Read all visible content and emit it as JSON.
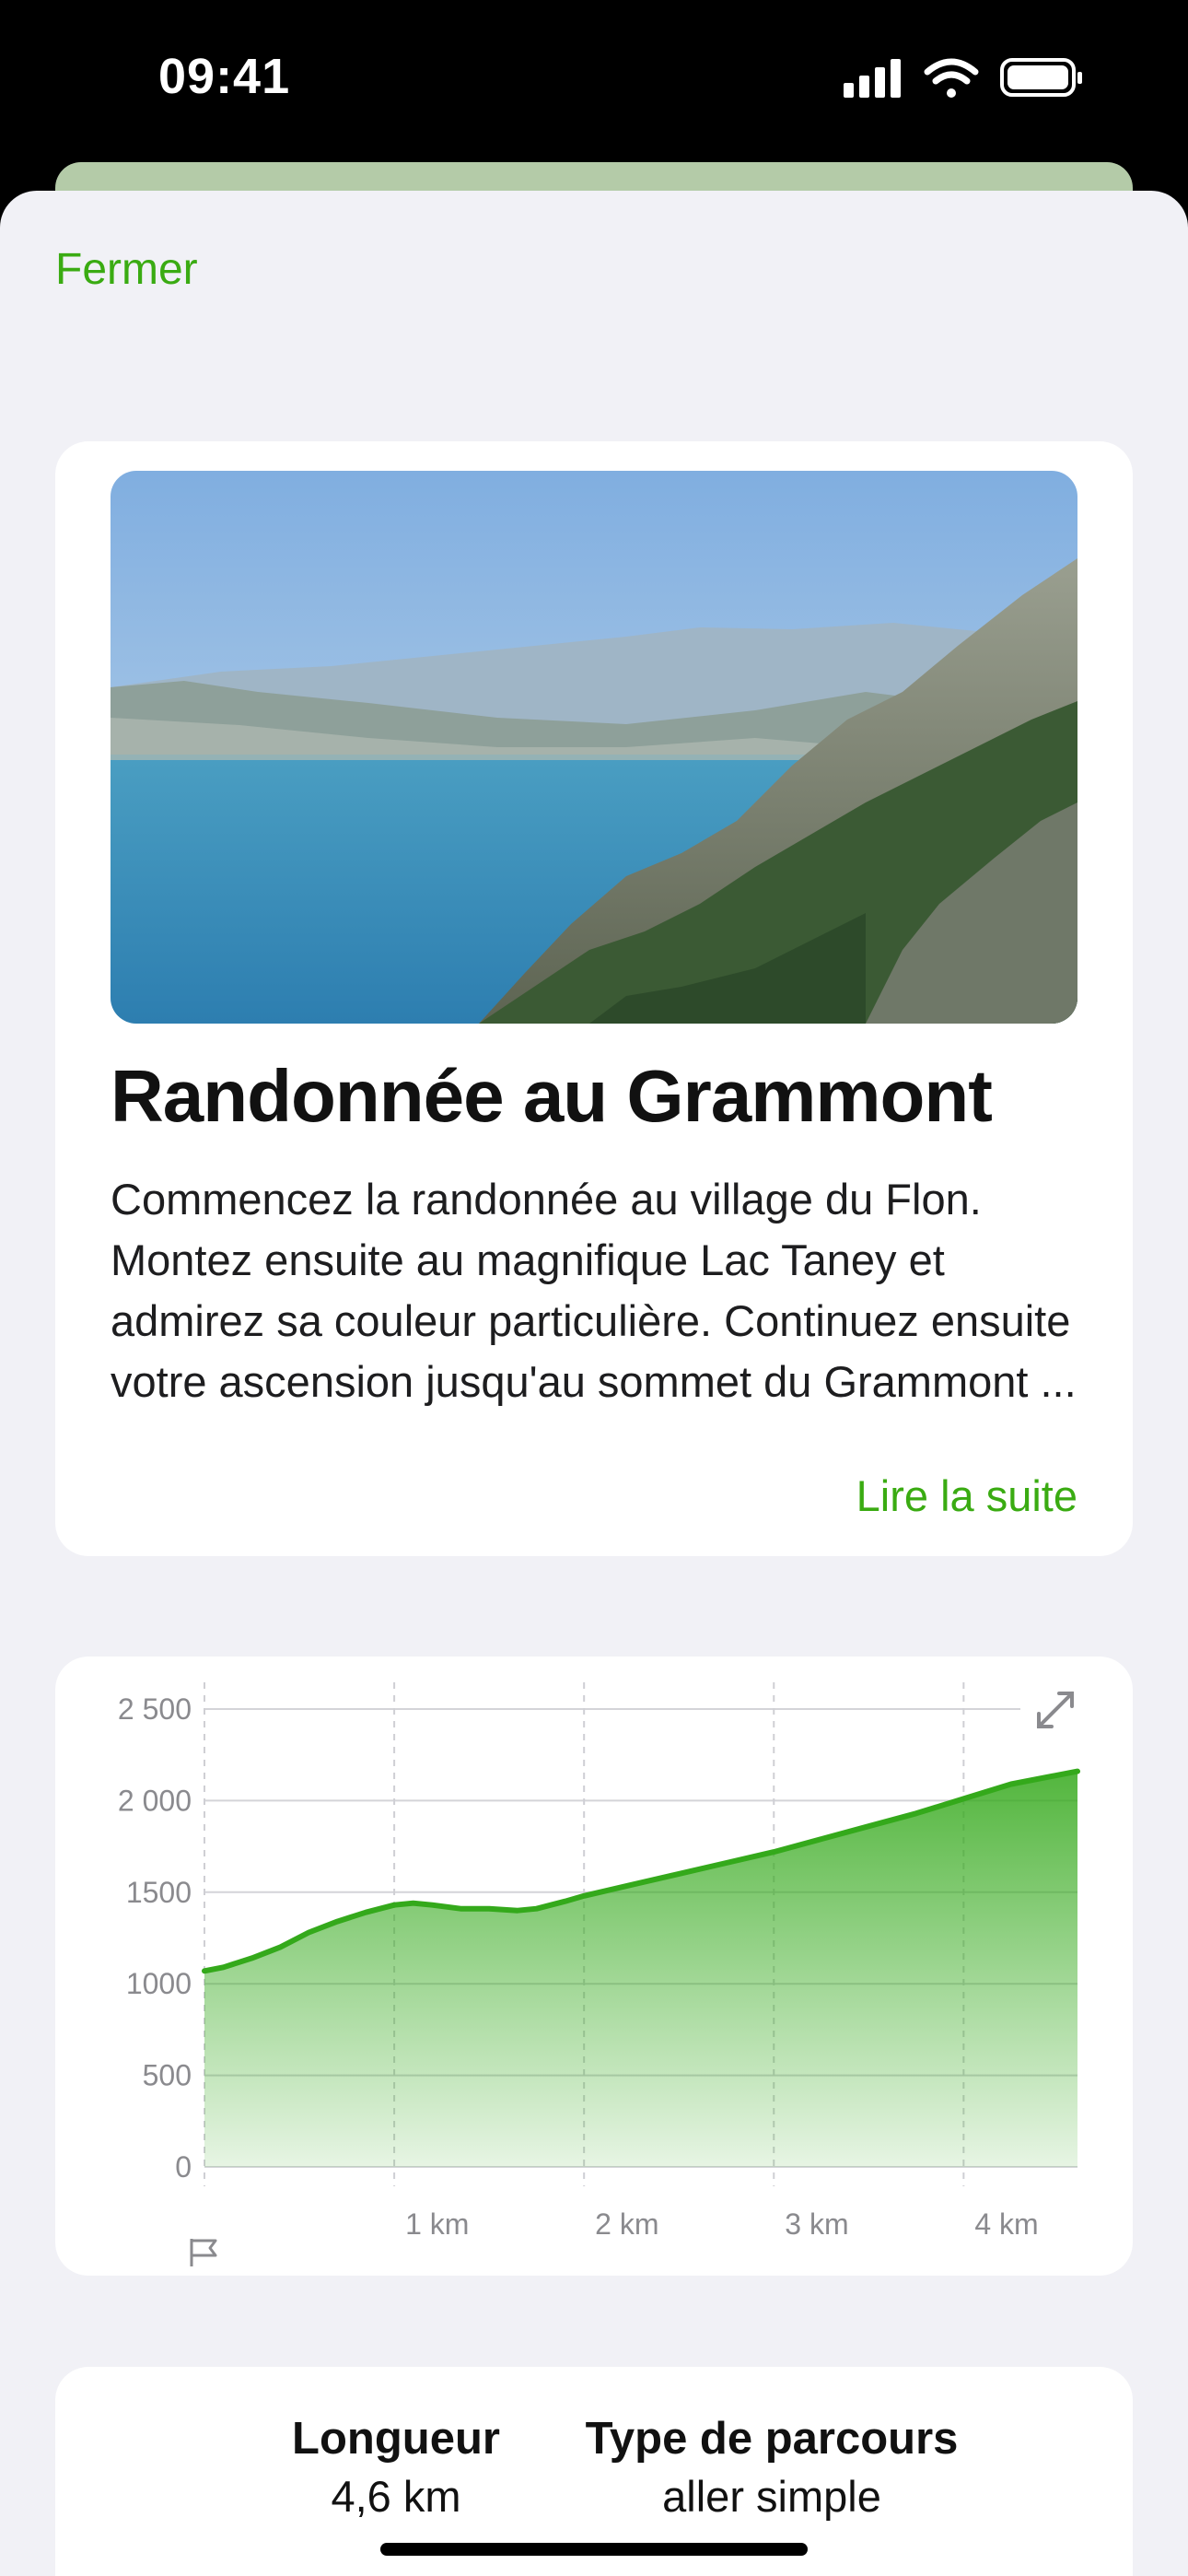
{
  "status_bar": {
    "time": "09:41"
  },
  "sheet": {
    "close_label": "Fermer"
  },
  "hike": {
    "title": "Randonnée au Grammont",
    "description": "Commencez la randonnée au village du Flon. Montez ensuite au magnifique Lac Taney et admirez sa couleur particulière. Continuez ensuite votre ascension jusqu'au sommet du Grammont ...",
    "read_more_label": "Lire la suite"
  },
  "stats": {
    "length_label": "Longueur",
    "length_value": "4,6 km",
    "route_type_label": "Type de parcours",
    "route_type_value": "aller simple"
  },
  "colors": {
    "accent": "#3aab12",
    "chart_line": "#34a91b",
    "sheet_bg": "#f1f1f6"
  },
  "icons": [
    "signal-icon",
    "wifi-icon",
    "battery-icon",
    "expand-icon",
    "start-flag-icon"
  ],
  "chart_data": {
    "type": "area",
    "title": "",
    "xlabel": "",
    "ylabel": "",
    "x_unit": "km",
    "x": [
      0,
      0.1,
      0.25,
      0.4,
      0.55,
      0.7,
      0.85,
      1.0,
      1.1,
      1.2,
      1.35,
      1.5,
      1.65,
      1.75,
      1.9,
      2.0,
      2.25,
      2.5,
      2.75,
      3.0,
      3.25,
      3.5,
      3.75,
      4.0,
      4.25,
      4.6
    ],
    "y": [
      1070,
      1090,
      1140,
      1200,
      1280,
      1340,
      1390,
      1430,
      1440,
      1430,
      1410,
      1410,
      1400,
      1410,
      1450,
      1480,
      1540,
      1600,
      1660,
      1720,
      1790,
      1860,
      1930,
      2010,
      2090,
      2160
    ],
    "ylim": [
      0,
      2500
    ],
    "yticks": [
      0,
      500,
      1000,
      1500,
      2000,
      2500
    ],
    "ytick_labels": [
      "0",
      "500",
      "1000",
      "1500",
      "2 000",
      "2 500"
    ],
    "xlim": [
      0,
      4.6
    ],
    "xticks": [
      1,
      2,
      3,
      4
    ],
    "xtick_labels": [
      "1 km",
      "2 km",
      "3 km",
      "4 km"
    ],
    "grid": true
  }
}
